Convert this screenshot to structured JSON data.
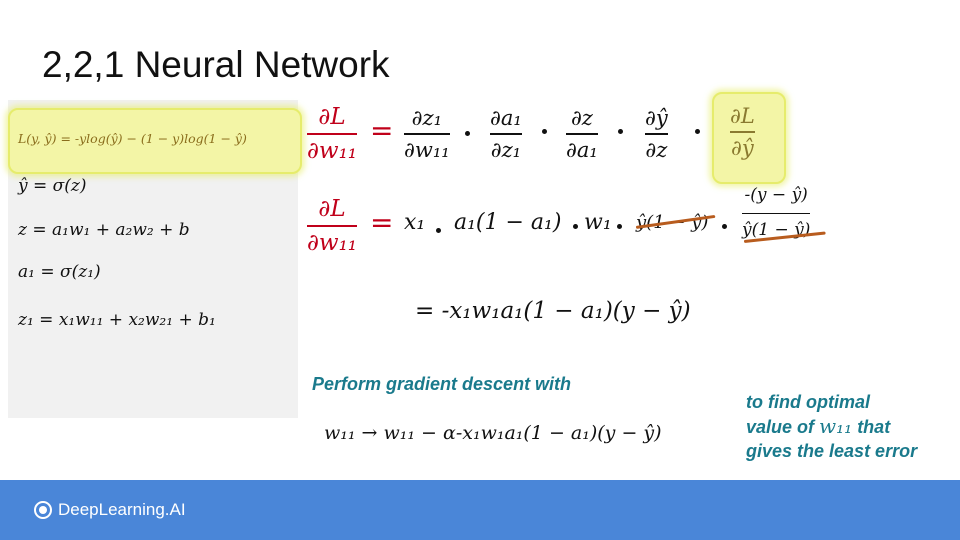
{
  "title": "2,2,1 Neural Network",
  "loss": "L(y, ŷ) =  -ylog(ŷ)  −  (1 − y)log(1 − ŷ)",
  "definitions": [
    "ŷ = σ(z)",
    "z = a₁w₁ + a₂w₂ + b",
    "a₁ = σ(z₁)",
    "z₁ = x₁w₁₁ + x₂w₂₁ + b₁"
  ],
  "chain": {
    "lhs_num": "∂L",
    "lhs_den": "∂w₁₁",
    "eq": "=",
    "factors": [
      {
        "num": "∂z₁",
        "den": "∂w₁₁"
      },
      {
        "num": "∂a₁",
        "den": "∂z₁"
      },
      {
        "num": "∂z",
        "den": "∂a₁"
      },
      {
        "num": "∂ŷ",
        "den": "∂z"
      },
      {
        "num": "∂L",
        "den": "∂ŷ"
      }
    ]
  },
  "row2": {
    "lhs_num": "∂L",
    "lhs_den": "∂w₁₁",
    "eq": "=",
    "x1": "x₁",
    "a_term": "a₁(1 − a₁)",
    "w1": "w₁",
    "struck": "ŷ(1 − ŷ)",
    "frac_num": "-(y  −  ŷ)",
    "frac_den": "ŷ(1 − ŷ)"
  },
  "row3": "= -x₁w₁a₁(1 − a₁)(y  −  ŷ)",
  "descent_label": "Perform gradient descent with",
  "update_rule": "w₁₁  →  w₁₁ − α-x₁w₁a₁(1 − a₁)(y  −  ŷ)",
  "note": {
    "line1": "to find optimal",
    "line2a": "value of ",
    "line2b": "w₁₁",
    "line2c": " that",
    "line3": "gives the least error"
  },
  "brand": "DeepLearning.AI"
}
